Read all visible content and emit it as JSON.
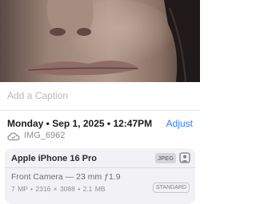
{
  "caption": {
    "placeholder": "Add a Caption"
  },
  "header": {
    "datetime": "Monday • Sep 1, 2025 • 12:47PM",
    "adjust_label": "Adjust"
  },
  "file": {
    "name": "IMG_6962",
    "icon": "cloud-icon"
  },
  "camera": {
    "model": "Apple iPhone 16 Pro",
    "format_badge": "JPEG",
    "lens": "Front Camera — 23 mm ƒ1.9",
    "specs": "7 MP • 2316 × 3088 • 2.1 MB",
    "style_badge": "STANDARD"
  },
  "colors": {
    "accent": "#2f7bf5",
    "card_bg": "#f2f2f6"
  }
}
